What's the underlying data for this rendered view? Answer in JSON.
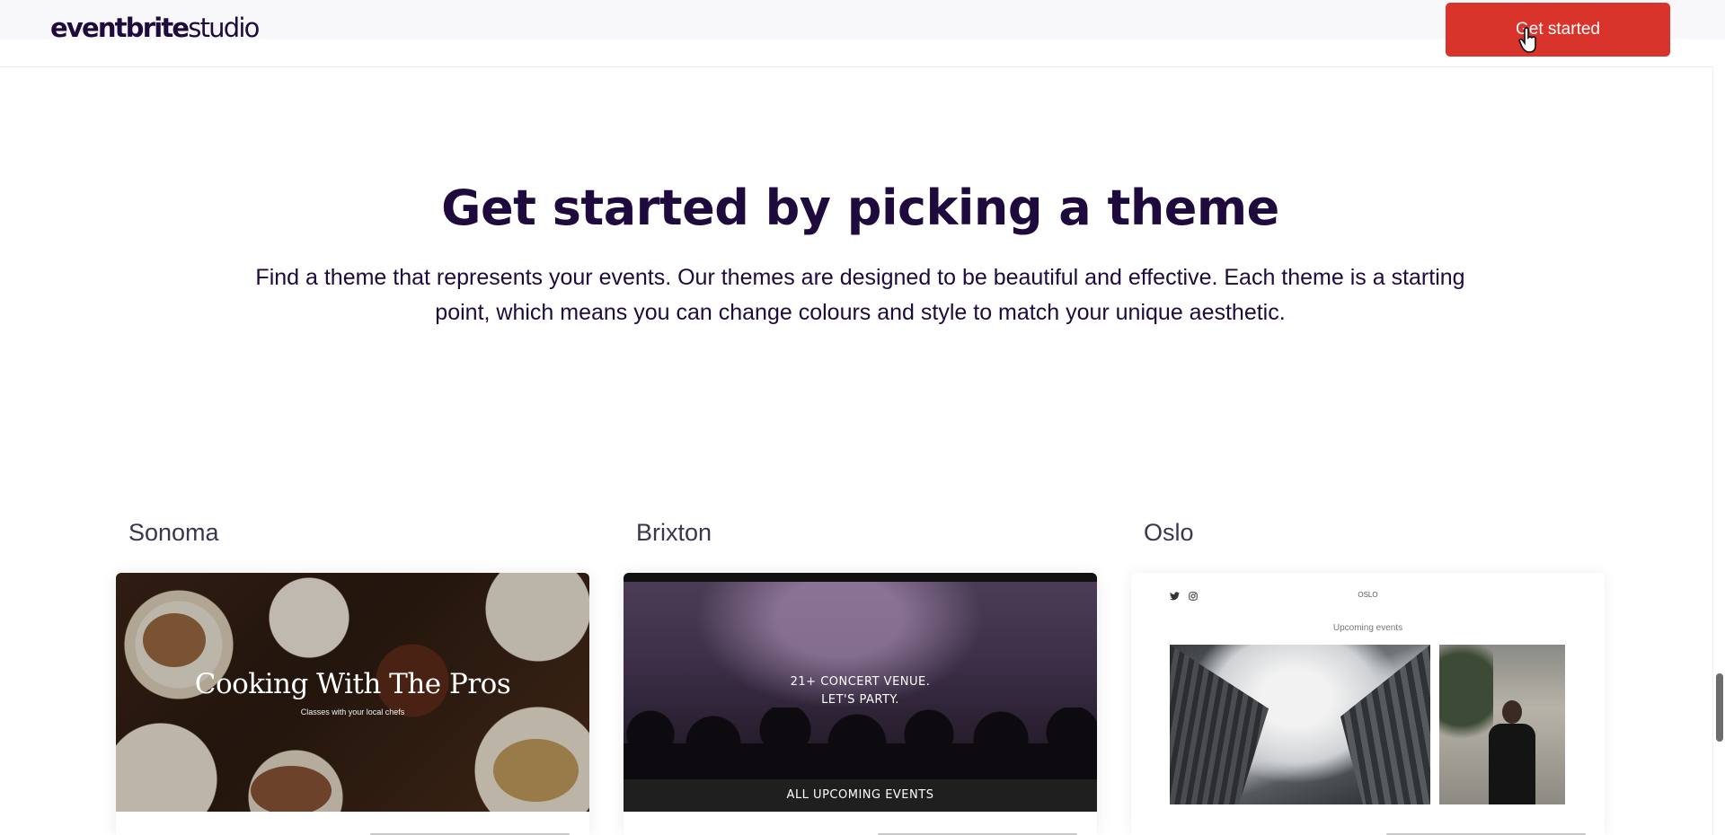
{
  "header": {
    "logo_brand": "eventbrite",
    "logo_product": "studio",
    "cta_label": "Get started"
  },
  "hero": {
    "title": "Get started by picking a theme",
    "description": "Find a theme that represents your events. Our themes are designed to be beautiful and effective. Each theme is a starting point, which means you can change colours and style to match your unique aesthetic."
  },
  "themes": [
    {
      "name": "Sonoma",
      "preview_title": "Cooking With The Pros",
      "preview_subtitle": "Classes with your local chefs"
    },
    {
      "name": "Brixton",
      "preview_line1": "21+ CONCERT VENUE.",
      "preview_line2": "LET'S PARTY.",
      "preview_band": "ALL UPCOMING EVENTS"
    },
    {
      "name": "Oslo",
      "preview_brand": "OSLO",
      "preview_subheading": "Upcoming events"
    }
  ],
  "colors": {
    "brand_dark": "#1e0a3c",
    "cta": "#d9342b"
  },
  "icons": {
    "twitter": "twitter-icon",
    "instagram": "instagram-icon",
    "cursor": "hand-pointer-icon"
  }
}
